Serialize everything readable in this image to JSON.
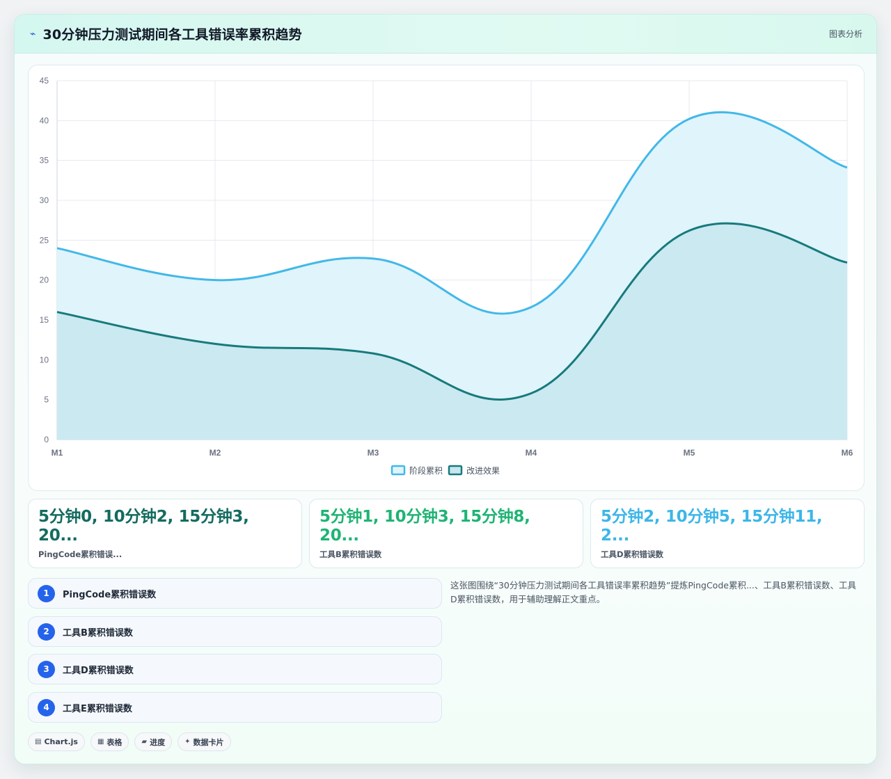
{
  "header": {
    "icon": "bolt-icon",
    "title": "30分钟压力测试期间各工具错误率累积趋势",
    "tag": "图表分析"
  },
  "chart_data": {
    "type": "area",
    "categories": [
      "M1",
      "M2",
      "M3",
      "M4",
      "M5",
      "M6"
    ],
    "ylim": [
      0,
      45
    ],
    "yticks": [
      0,
      5,
      10,
      15,
      20,
      25,
      30,
      35,
      40,
      45
    ],
    "grid": true,
    "legend_position": "bottom",
    "series": [
      {
        "name": "阶段累积",
        "values": [
          24,
          20,
          22.7,
          16.6,
          40.2,
          34.1
        ],
        "color": "#42b8e8",
        "fill": "#e0f4fb"
      },
      {
        "name": "改进效果",
        "values": [
          16,
          12,
          10.8,
          5.8,
          26.2,
          22.2
        ],
        "color": "#177a7c",
        "fill": "#c7e6ed"
      }
    ]
  },
  "stats": [
    {
      "value": "5分钟0, 10分钟2, 15分钟3, 20...",
      "label": "PingCode累积错误...",
      "color": "#146b60"
    },
    {
      "value": "5分钟1, 10分钟3, 15分钟8, 20...",
      "label": "工具B累积错误数",
      "color": "#1fb474"
    },
    {
      "value": "5分钟2, 10分钟5, 15分钟11, 2...",
      "label": "工具D累积错误数",
      "color": "#3db6e8"
    }
  ],
  "list": [
    {
      "num": "1",
      "label": "PingCode累积错误数"
    },
    {
      "num": "2",
      "label": "工具B累积错误数"
    },
    {
      "num": "3",
      "label": "工具D累积错误数"
    },
    {
      "num": "4",
      "label": "工具E累积错误数"
    }
  ],
  "description": "这张图围绕“30分钟压力测试期间各工具错误率累积趋势”提炼PingCode累积...、工具B累积错误数、工具D累积错误数，用于辅助理解正文重点。",
  "chips": [
    {
      "icon": "▤",
      "label": "Chart.js"
    },
    {
      "icon": "▦",
      "label": "表格"
    },
    {
      "icon": "▰",
      "label": "进度"
    },
    {
      "icon": "✦",
      "label": "数据卡片"
    }
  ]
}
